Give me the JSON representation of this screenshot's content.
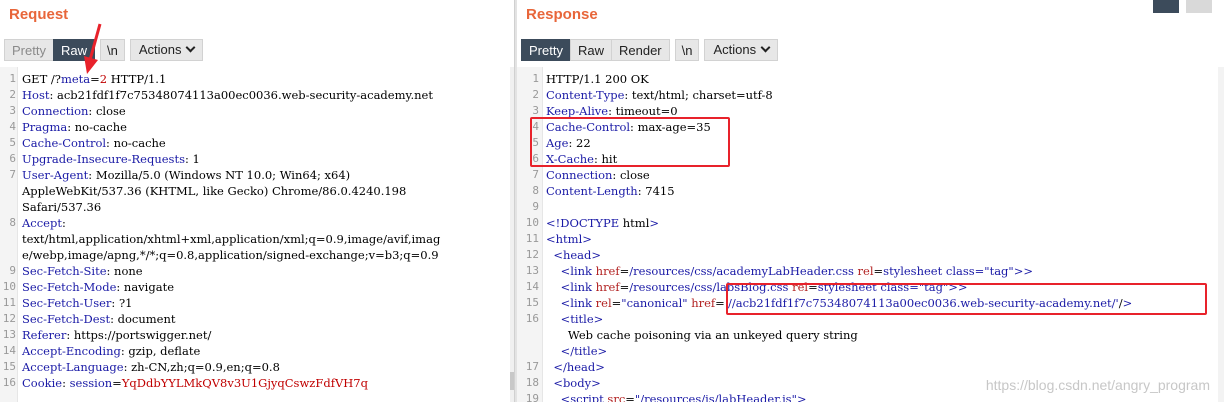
{
  "request": {
    "title": "Request",
    "tabs": [
      "Pretty",
      "Raw",
      "\\n"
    ],
    "active_tab": "Raw",
    "actions_label": "Actions",
    "lines": [
      {
        "n": "1",
        "t": "GET /?meta=2 HTTP/1.1"
      },
      {
        "n": "2",
        "t": "Host: acb21fdf1f7c75348074113a00ec0036.web-security-academy.net"
      },
      {
        "n": "3",
        "t": "Connection: close"
      },
      {
        "n": "4",
        "t": "Pragma: no-cache"
      },
      {
        "n": "5",
        "t": "Cache-Control: no-cache"
      },
      {
        "n": "6",
        "t": "Upgrade-Insecure-Requests: 1"
      },
      {
        "n": "7",
        "t": "User-Agent: Mozilla/5.0 (Windows NT 10.0; Win64; x64)"
      },
      {
        "n": "",
        "t": "AppleWebKit/537.36 (KHTML, like Gecko) Chrome/86.0.4240.198"
      },
      {
        "n": "",
        "t": "Safari/537.36"
      },
      {
        "n": "8",
        "t": "Accept:"
      },
      {
        "n": "",
        "t": "text/html,application/xhtml+xml,application/xml;q=0.9,image/avif,imag"
      },
      {
        "n": "",
        "t": "e/webp,image/apng,*/*;q=0.8,application/signed-exchange;v=b3;q=0.9"
      },
      {
        "n": "9",
        "t": "Sec-Fetch-Site: none"
      },
      {
        "n": "10",
        "t": "Sec-Fetch-Mode: navigate"
      },
      {
        "n": "11",
        "t": "Sec-Fetch-User: ?1"
      },
      {
        "n": "12",
        "t": "Sec-Fetch-Dest: document"
      },
      {
        "n": "13",
        "t": "Referer: https://portswigger.net/"
      },
      {
        "n": "14",
        "t": "Accept-Encoding: gzip, deflate"
      },
      {
        "n": "15",
        "t": "Accept-Language: zh-CN,zh;q=0.9,en;q=0.8"
      },
      {
        "n": "16",
        "t": "Cookie: session=YqDdbYYLMkQV8v3U1GjyqCswzFdfVH7q"
      }
    ]
  },
  "response": {
    "title": "Response",
    "tabs": [
      "Pretty",
      "Raw",
      "Render",
      "\\n"
    ],
    "active_tab": "Pretty",
    "actions_label": "Actions",
    "lines": [
      {
        "n": "1",
        "t": "HTTP/1.1 200 OK"
      },
      {
        "n": "2",
        "t": "Content-Type: text/html; charset=utf-8"
      },
      {
        "n": "3",
        "t": "Keep-Alive: timeout=0"
      },
      {
        "n": "4",
        "t": "Cache-Control: max-age=35"
      },
      {
        "n": "5",
        "t": "Age: 22"
      },
      {
        "n": "6",
        "t": "X-Cache: hit"
      },
      {
        "n": "7",
        "t": "Connection: close"
      },
      {
        "n": "8",
        "t": "Content-Length: 7415"
      },
      {
        "n": "9",
        "t": ""
      },
      {
        "n": "10",
        "t": "<!DOCTYPE html>"
      },
      {
        "n": "11",
        "t": "<html>"
      },
      {
        "n": "12",
        "t": "  <head>"
      },
      {
        "n": "13",
        "t": "    <link href=/resources/css/academyLabHeader.css rel=stylesheet>"
      },
      {
        "n": "14",
        "t": "    <link href=/resources/css/labsBlog.css rel=stylesheet>"
      },
      {
        "n": "15",
        "t": "    <link rel=\"canonical\" href='//acb21fdf1f7c75348074113a00ec0036.web-security-academy.net/'/>"
      },
      {
        "n": "16",
        "t": "    <title>"
      },
      {
        "n": "",
        "t": "      Web cache poisoning via an unkeyed query string"
      },
      {
        "n": "",
        "t": "    </title>"
      },
      {
        "n": "17",
        "t": "  </head>"
      },
      {
        "n": "18",
        "t": "  <body>"
      },
      {
        "n": "19",
        "t": "    <script src=\"/resources/js/labHeader.js\">"
      }
    ]
  },
  "watermark": "https://blog.csdn.net/angry_program",
  "colors": {
    "accent": "#e8663a",
    "highlight": "#e8222b",
    "header_key": "#1a1aa6",
    "value_red": "#c00000"
  }
}
